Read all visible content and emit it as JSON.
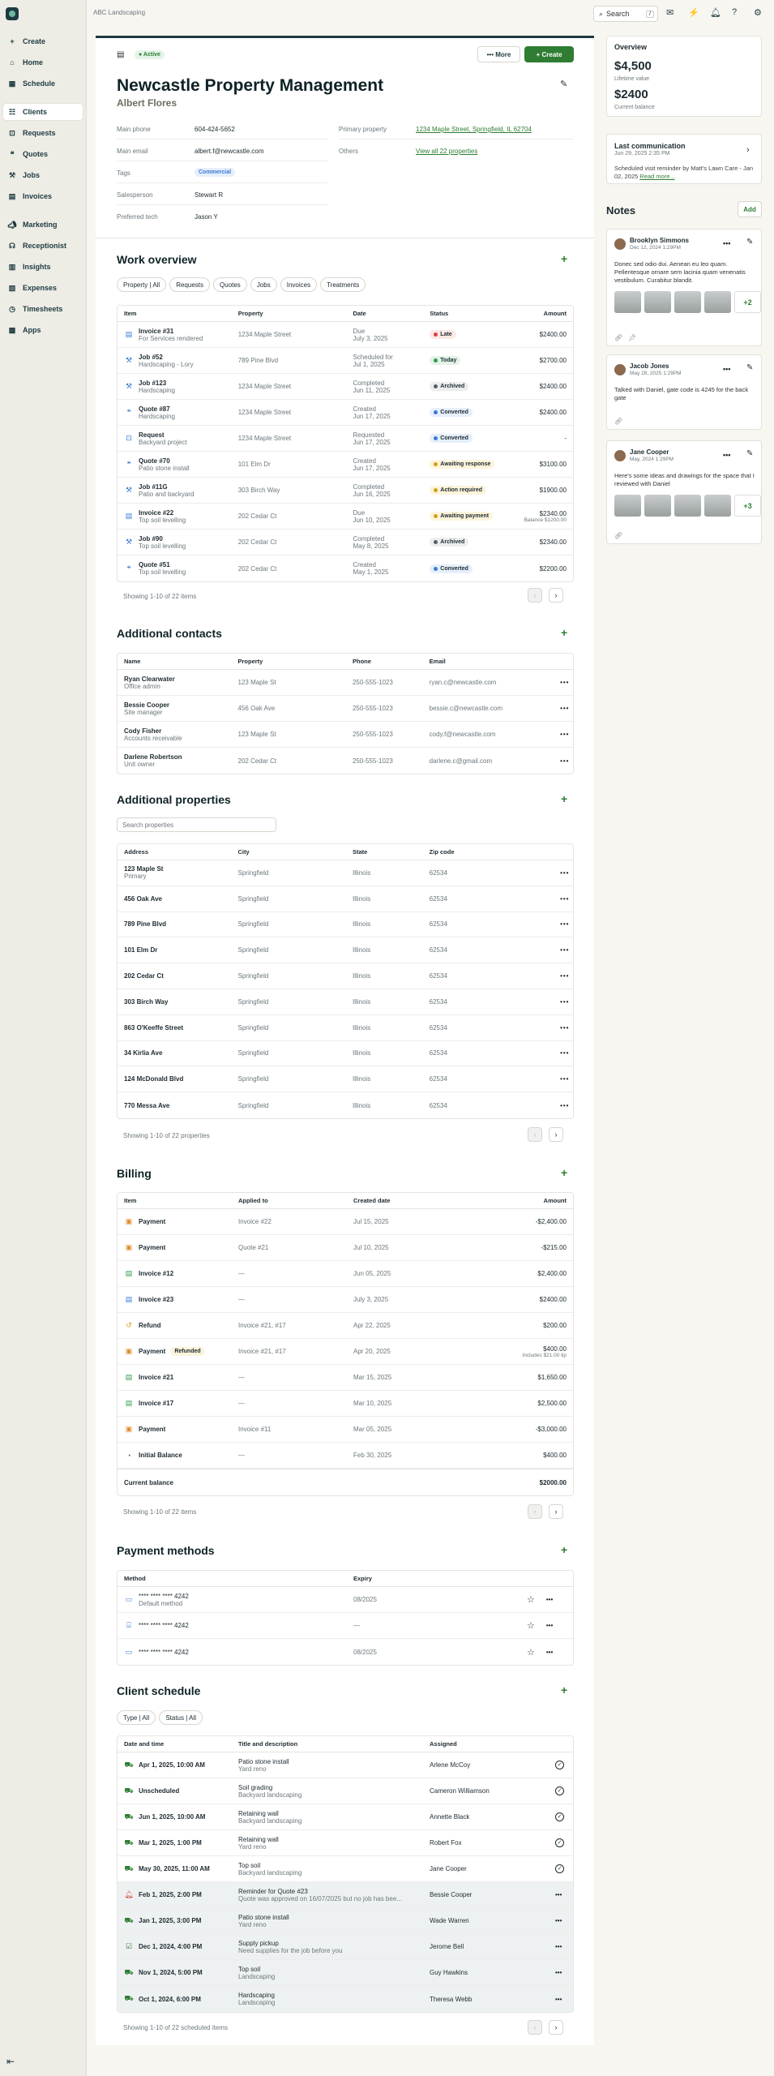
{
  "company": "ABC Landscaping",
  "search": {
    "label": "Search",
    "kbd": "/"
  },
  "nav": [
    {
      "label": "Create",
      "icon": "plus-icon"
    },
    {
      "label": "Home",
      "icon": "home-icon"
    },
    {
      "label": "Schedule",
      "icon": "calendar-icon"
    },
    {
      "label": "Clients",
      "icon": "clients-icon"
    },
    {
      "label": "Requests",
      "icon": "inbox-icon"
    },
    {
      "label": "Quotes",
      "icon": "quote-icon"
    },
    {
      "label": "Jobs",
      "icon": "hammer-icon"
    },
    {
      "label": "Invoices",
      "icon": "invoice-icon"
    },
    {
      "label": "Marketing",
      "icon": "megaphone-icon"
    },
    {
      "label": "Receptionist",
      "icon": "headset-icon"
    },
    {
      "label": "Insights",
      "icon": "chart-icon"
    },
    {
      "label": "Expenses",
      "icon": "expense-icon"
    },
    {
      "label": "Timesheets",
      "icon": "clock-icon"
    },
    {
      "label": "Apps",
      "icon": "apps-icon"
    }
  ],
  "client": {
    "status": "Active",
    "more": "More",
    "create": "Create",
    "name": "Newcastle Property Management",
    "contact": "Albert Flores",
    "fields": {
      "main_phone_label": "Main phone",
      "main_phone": "604-424-5652",
      "main_email_label": "Main email",
      "main_email": "albert.f@newcastle.com",
      "tags_label": "Tags",
      "tag": "Commercial",
      "salesperson_label": "Salesperson",
      "salesperson": "Stewart R",
      "tech_label": "Preferred tech",
      "tech": "Jason Y",
      "property_label": "Primary property",
      "property": "1234 Maple Street, Springfield, IL 62704",
      "others_label": "Others",
      "others": "View all 22 properties"
    }
  },
  "work": {
    "title": "Work overview",
    "filters": [
      "Property | All",
      "Requests",
      "Quotes",
      "Jobs",
      "Invoices",
      "Treatments"
    ],
    "headers": [
      "Item",
      "Property",
      "Date",
      "Status",
      "Amount"
    ],
    "rows": [
      {
        "t": "Invoice #31",
        "s": "For Services rendered",
        "p": "1234 Maple Street",
        "d1": "Due",
        "d2": "July 3, 2025",
        "st": "Late",
        "sc": "#d6453d",
        "sb": "#fde8e6",
        "a": "$2400.00",
        "a2": "",
        "ic": "invoice-icon"
      },
      {
        "t": "Job #52",
        "s": "Hardscaping - Lory",
        "p": "789 Pine Blvd",
        "d1": "Scheduled for",
        "d2": "Jul 1, 2025",
        "st": "Today",
        "sc": "#2e9c4b",
        "sb": "#e3f4e7",
        "a": "$2700.00",
        "a2": "",
        "ic": "job-icon"
      },
      {
        "t": "Job #123",
        "s": "Hardscaping",
        "p": "1234 Maple Street",
        "d1": "Completed",
        "d2": "Jun 11, 2025",
        "st": "Archived",
        "sc": "#556066",
        "sb": "#eceeee",
        "a": "$2400.00",
        "a2": "",
        "ic": "job-icon"
      },
      {
        "t": "Quote #87",
        "s": "Hardscaping",
        "p": "1234 Maple Street",
        "d1": "Created",
        "d2": "Jun 17, 2025",
        "st": "Converted",
        "sc": "#3a7bd5",
        "sb": "#e6effb",
        "a": "$2400.00",
        "a2": "",
        "ic": "quote-icon"
      },
      {
        "t": "Request",
        "s": "Backyard project",
        "p": "1234 Maple Street",
        "d1": "Requested",
        "d2": "Jun 17, 2025",
        "st": "Converted",
        "sc": "#3a7bd5",
        "sb": "#e6effb",
        "a": "-",
        "a2": "",
        "ic": "request-icon"
      },
      {
        "t": "Quote #70",
        "s": "Patio stone install",
        "p": "101 Elm Dr",
        "d1": "Created",
        "d2": "Jun 17, 2025",
        "st": "Awaiting response",
        "sc": "#d4a017",
        "sb": "#fdf4dc",
        "a": "$3100.00",
        "a2": "",
        "ic": "quote-icon"
      },
      {
        "t": "Job #11G",
        "s": "Patio and backyard",
        "p": "303 Birch Way",
        "d1": "Completed",
        "d2": "Jun 16, 2025",
        "st": "Action required",
        "sc": "#d4a017",
        "sb": "#fdf4dc",
        "a": "$1900.00",
        "a2": "",
        "ic": "job-icon"
      },
      {
        "t": "Invoice #22",
        "s": "Top soil levelling",
        "p": "202 Cedar Ct",
        "d1": "Due",
        "d2": "Jun 10, 2025",
        "st": "Awaiting payment",
        "sc": "#d4a017",
        "sb": "#fdf4dc",
        "a": "$2340.00",
        "a2": "Balance $1200.00",
        "ic": "invoice-icon"
      },
      {
        "t": "Job #90",
        "s": "Top soil levelling",
        "p": "202 Cedar Ct",
        "d1": "Completed",
        "d2": "May 8, 2025",
        "st": "Archived",
        "sc": "#556066",
        "sb": "#eceeee",
        "a": "$2340.00",
        "a2": "",
        "ic": "job-icon"
      },
      {
        "t": "Quote #51",
        "s": "Top soil levelling",
        "p": "202 Cedar Ct",
        "d1": "Created",
        "d2": "May 1, 2025",
        "st": "Converted",
        "sc": "#3a7bd5",
        "sb": "#e6effb",
        "a": "$2200.00",
        "a2": "",
        "ic": "quote-icon"
      }
    ],
    "pager": "Showing 1-10 of 22 items"
  },
  "contacts": {
    "title": "Additional contacts",
    "headers": [
      "Name",
      "Property",
      "Phone",
      "Email"
    ],
    "rows": [
      {
        "n": "Ryan Clearwater",
        "r": "Office admin",
        "p": "123 Maple St",
        "ph": "250-555-1023",
        "e": "ryan.c@newcastle.com"
      },
      {
        "n": "Bessie Cooper",
        "r": "Site manager",
        "p": "456 Oak Ave",
        "ph": "250-555-1023",
        "e": "bessie.c@newcastle.com"
      },
      {
        "n": "Cody Fisher",
        "r": "Accounts receivable",
        "p": "123 Maple St",
        "ph": "250-555-1023",
        "e": "cody.f@newcastle.com"
      },
      {
        "n": "Darlene Robertson",
        "r": "Unit owner",
        "p": "202 Cedar Ct",
        "ph": "250-555-1023",
        "e": "darlene.c@gmail.com"
      }
    ]
  },
  "properties": {
    "title": "Additional properties",
    "search_placeholder": "Search properties",
    "headers": [
      "Address",
      "City",
      "State",
      "Zip code"
    ],
    "rows": [
      {
        "a": "123 Maple St",
        "s": "Primary",
        "c": "Springfield",
        "st": "Illinois",
        "z": "62534"
      },
      {
        "a": "456 Oak Ave",
        "s": "",
        "c": "Springfield",
        "st": "Illinois",
        "z": "62534"
      },
      {
        "a": "789 Pine Blvd",
        "s": "",
        "c": "Springfield",
        "st": "Illinois",
        "z": "62534"
      },
      {
        "a": "101 Elm Dr",
        "s": "",
        "c": "Springfield",
        "st": "Illinois",
        "z": "62534"
      },
      {
        "a": "202 Cedar Ct",
        "s": "",
        "c": "Springfield",
        "st": "Illinois",
        "z": "62534"
      },
      {
        "a": "303 Birch Way",
        "s": "",
        "c": "Springfield",
        "st": "Illinois",
        "z": "62534"
      },
      {
        "a": "863 O'Keeffe Street",
        "s": "",
        "c": "Springfield",
        "st": "Illinois",
        "z": "62534"
      },
      {
        "a": "34 Kirlia Ave",
        "s": "",
        "c": "Springfield",
        "st": "Illinois",
        "z": "62534"
      },
      {
        "a": "124 McDonald Blvd",
        "s": "",
        "c": "Springfield",
        "st": "Illinois",
        "z": "62534"
      },
      {
        "a": "770 Messa Ave",
        "s": "",
        "c": "Springfield",
        "st": "Illinois",
        "z": "62534"
      }
    ],
    "pager": "Showing 1-10 of 22 properties"
  },
  "billing": {
    "title": "Billing",
    "headers": [
      "Item",
      "Applied to",
      "Created date",
      "Amount"
    ],
    "rows": [
      {
        "i": "Payment",
        "tag": "",
        "ap": "Invoice #22",
        "d": "Jul 15, 2025",
        "a": "-$2,400.00",
        "a2": "",
        "ic": "payment-icon",
        "col": "#e08a2b"
      },
      {
        "i": "Payment",
        "tag": "",
        "ap": "Quote #21",
        "d": "Jul 10, 2025",
        "a": "-$215.00",
        "a2": "",
        "ic": "payment-icon",
        "col": "#e08a2b"
      },
      {
        "i": "Invoice #12",
        "tag": "",
        "ap": "—",
        "d": "Jun 05, 2025",
        "a": "$2,400.00",
        "a2": "",
        "ic": "invoice-icon",
        "col": "#2e9c4b"
      },
      {
        "i": "Invoice #23",
        "tag": "",
        "ap": "—",
        "d": "July 3, 2025",
        "a": "$2400.00",
        "a2": "",
        "ic": "invoice-icon",
        "col": "#3a7bd5"
      },
      {
        "i": "Refund",
        "tag": "",
        "ap": "Invoice #21, #17",
        "d": "Apr 22, 2025",
        "a": "$200.00",
        "a2": "",
        "ic": "refund-icon",
        "col": "#d4a017"
      },
      {
        "i": "Payment",
        "tag": "Refunded",
        "ap": "Invoice #21, #17",
        "d": "Apr 20, 2025",
        "a": "$400.00",
        "a2": "Includes $21.00 tip",
        "ic": "payment-icon",
        "col": "#e08a2b"
      },
      {
        "i": "Invoice #21",
        "tag": "",
        "ap": "—",
        "d": "Mar 15, 2025",
        "a": "$1,650.00",
        "a2": "",
        "ic": "invoice-icon",
        "col": "#2e9c4b"
      },
      {
        "i": "Invoice #17",
        "tag": "",
        "ap": "—",
        "d": "Mar 10, 2025",
        "a": "$2,500.00",
        "a2": "",
        "ic": "invoice-icon",
        "col": "#2e9c4b"
      },
      {
        "i": "Payment",
        "tag": "",
        "ap": "Invoice #11",
        "d": "Mar 05, 2025",
        "a": "-$3,000.00",
        "a2": "",
        "ic": "payment-icon",
        "col": "#e08a2b"
      },
      {
        "i": "Initial Balance",
        "tag": "",
        "ap": "—",
        "d": "Feb 30, 2025",
        "a": "$400.00",
        "a2": "",
        "ic": "balance-icon",
        "col": "#556066"
      }
    ],
    "balance_label": "Current balance",
    "balance": "$2000.00",
    "pager": "Showing 1-10 of 22 items"
  },
  "payments": {
    "title": "Payment methods",
    "headers": [
      "Method",
      "Expiry"
    ],
    "rows": [
      {
        "m": "**** **** **** 4242",
        "s": "Default method",
        "e": "08/2025",
        "ic": "card-icon"
      },
      {
        "m": "**** **** **** 4242",
        "s": "",
        "e": "—",
        "ic": "bank-icon"
      },
      {
        "m": "**** **** **** 4242",
        "s": "",
        "e": "08/2025",
        "ic": "card-icon"
      }
    ]
  },
  "schedule": {
    "title": "Client schedule",
    "filters": [
      "Type | All",
      "Status | All"
    ],
    "headers": [
      "Date and time",
      "Title and description",
      "Assigned"
    ],
    "rows": [
      {
        "d": "Apr 1, 2025, 10:00 AM",
        "t": "Patio stone install",
        "s": "Yard reno",
        "as": "Arlene McCoy",
        "ic": "truck-icon",
        "done": true,
        "hl": false
      },
      {
        "d": "Unscheduled",
        "t": "Soil grading",
        "s": "Backyard landscaping",
        "as": "Cameron Williamson",
        "ic": "truck-icon",
        "done": true,
        "hl": false
      },
      {
        "d": "Jun 1, 2025, 10:00 AM",
        "t": "Retaining wall",
        "s": "Backyard landscaping",
        "as": "Annette Black",
        "ic": "truck-icon",
        "done": true,
        "hl": false
      },
      {
        "d": "Mar 1, 2025, 1:00 PM",
        "t": "Retaining wall",
        "s": "Yard reno",
        "as": "Robert Fox",
        "ic": "truck-icon",
        "done": true,
        "hl": false
      },
      {
        "d": "May 30, 2025, 11:00 AM",
        "t": "Top soil",
        "s": "Backyard landscaping",
        "as": "Jane Cooper",
        "ic": "truck-icon",
        "done": true,
        "hl": false
      },
      {
        "d": "Feb 1, 2025, 2:00 PM",
        "t": "Reminder for Quote #23",
        "s": "Quote was approved on 16/07/2025 but no job has bee...",
        "as": "Bessie Cooper",
        "ic": "bell-icon",
        "done": false,
        "hl": true
      },
      {
        "d": "Jan 1, 2025, 3:00 PM",
        "t": "Patio stone install",
        "s": "Yard reno",
        "as": "Wade Warren",
        "ic": "truck-icon",
        "done": false,
        "hl": true
      },
      {
        "d": "Dec 1, 2024, 4:00 PM",
        "t": "Supply pickup",
        "s": "Need supplies for the job before you",
        "as": "Jerome Bell",
        "ic": "task-icon",
        "done": false,
        "hl": true
      },
      {
        "d": "Nov 1, 2024, 5:00 PM",
        "t": "Top soil",
        "s": "Landscaping",
        "as": "Guy Hawkins",
        "ic": "truck-icon",
        "done": false,
        "hl": true
      },
      {
        "d": "Oct 1, 2024, 6:00 PM",
        "t": "Hardscaping",
        "s": "Landscaping",
        "as": "Theresa Webb",
        "ic": "truck-icon",
        "done": false,
        "hl": true
      }
    ],
    "pager": "Showing 1-10 of 22 scheduled items"
  },
  "overview": {
    "title": "Overview",
    "ltv": "$4,500",
    "ltv_label": "Lifetime value",
    "bal": "$2400",
    "bal_label": "Current balance"
  },
  "lastcomm": {
    "title": "Last communication",
    "date": "Jun 29, 2025 2:35 PM",
    "text": "Scheduled visit reminder by Matt's Lawn Care - Jan 02, 2025",
    "read": "Read more..."
  },
  "notes": {
    "title": "Notes",
    "add": "Add",
    "items": [
      {
        "name": "Brooklyn Simmons",
        "date": "Dec 12, 2024 1:29PM",
        "text": "Donec sed odio dui. Aenean eu leo quam. Pellentesque ornare sem lacinia quam venenatis vestibulum. Curabitur blandit.",
        "more": "+2"
      },
      {
        "name": "Jacob Jones",
        "date": "May 28, 2025 1:29PM",
        "text": "Talked with Daniel, gate code is 4245 for the back gate",
        "more": ""
      },
      {
        "name": "Jane Cooper",
        "date": "May, 2024 1:29PM",
        "text": "Here's some ideas and drawings for the space that I reviewed with Daniel",
        "more": "+3"
      }
    ]
  }
}
